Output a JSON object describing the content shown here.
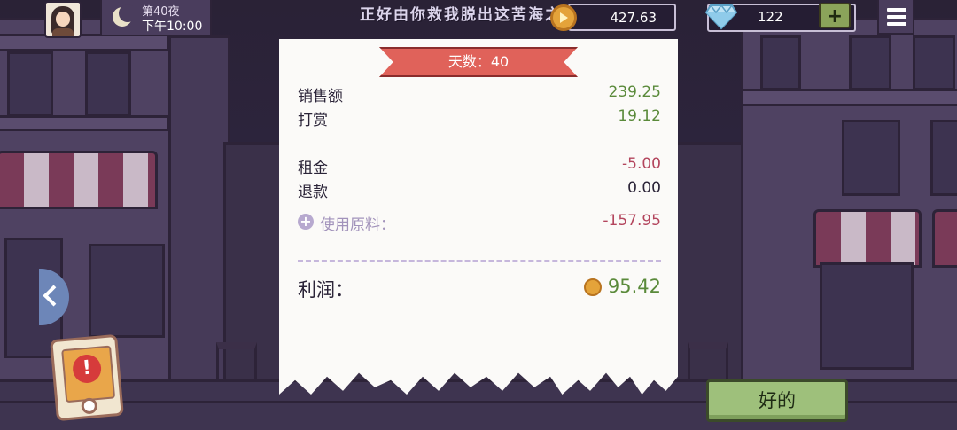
{
  "hud": {
    "night_label": "第40夜",
    "time": "下午10:00",
    "marquee": "正好由你救我脱出这苦海之花",
    "coins": "427.63",
    "gems": "122",
    "plus_label": "+"
  },
  "summary": {
    "day_label": "天数：40",
    "sales_label": "销售额",
    "sales_value": "239.25",
    "tips_label": "打赏",
    "tips_value": "19.12",
    "rent_label": "租金",
    "rent_value": "-5.00",
    "refund_label": "退款",
    "refund_value": "0.00",
    "ingredients_label": "使用原料：",
    "ingredients_value": "-157.95",
    "profit_label": "利润：",
    "profit_value": "95.42"
  },
  "buttons": {
    "ok_label": "好的",
    "alert_mark": "!"
  },
  "icons": {
    "expand": "+"
  },
  "colors": {
    "positive": "#5a8a3a",
    "negative": "#b3455d",
    "ribbon": "#e0625a",
    "ok_button": "#9ec07b"
  }
}
